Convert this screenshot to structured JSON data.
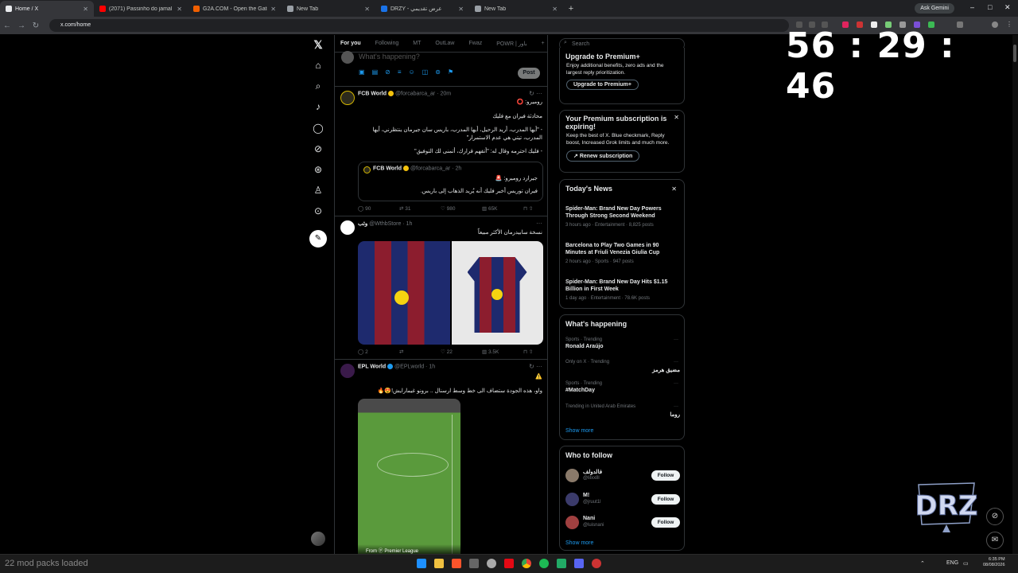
{
  "browser": {
    "tabs": [
      {
        "title": "Home / X",
        "active": true,
        "icon": "x-logo-icon",
        "color": "#e8eaed"
      },
      {
        "title": "(2071) Passinho do jamal - YouTube",
        "active": false,
        "icon": "youtube-icon",
        "color": "#ff0000"
      },
      {
        "title": "G2A.COM - Open the Gate 2 A",
        "active": false,
        "icon": "g2a-icon",
        "color": "#f05f00"
      },
      {
        "title": "New Tab",
        "active": false,
        "icon": "chrome-icon",
        "color": "#9aa0a6"
      },
      {
        "title": "DRZY - عرض تقديمي",
        "active": false,
        "icon": "slides-icon",
        "color": "#1a73e8"
      },
      {
        "title": "New Tab",
        "active": false,
        "icon": "chrome-icon",
        "color": "#9aa0a6"
      }
    ],
    "new_tab": "+",
    "ask_gemini": "Ask Gemini",
    "url": "x.com/home"
  },
  "x": {
    "tabs": [
      "For you",
      "Following",
      "MT",
      "OutLaw",
      "Fwaz",
      "POWR | باور"
    ],
    "composer_placeholder": "What's happening?",
    "post_button": "Post",
    "tweets": [
      {
        "name": "FCB World",
        "handle": "@forcabarca_ar · 20m",
        "lines": [
          "روميرو: ⭕",
          "محادثة فيران مع فليك",
          "- \"أيها المدرب، أريد الرحيل، أيها المدرب، باريس سان جيرمان ينتظرني، أيها المدرب، تيتي هي عدم الاستمرار\"",
          "- فليك احترمه وقال له: \"أتفهم قرارك، أتمنى لك التوفيق\""
        ],
        "quote": {
          "name": "FCB World",
          "handle": "@forcabarca_ar · 2h",
          "lines": [
            "جيرارد روميرو: 🚨",
            "فيران توريس أخبر فليك أنه يُريد الذهاب إلى باريس."
          ]
        },
        "stats": [
          "90",
          "31",
          "980",
          "65K"
        ]
      },
      {
        "name": "وثب",
        "handle": "@WthbStore · 1h",
        "lines": [
          "نسخة سابيدرمان الأكثر مبيعاً"
        ],
        "stats": [
          "2",
          "",
          "22",
          "3.5K"
        ]
      },
      {
        "name": "EPL World",
        "handle": "@EPLworld · 1h",
        "lines": [
          "⚠️",
          "واو، هذه الجودة ستضاف الى خط وسط ارسنال .. برونو غيمارايش!😍🔥"
        ],
        "media_caption": "From ⓟ Premier League"
      }
    ]
  },
  "sidebar": {
    "search_placeholder": "Search",
    "premium": {
      "title": "Upgrade to Premium+",
      "text": "Enjoy additional benefits, zero ads and the largest reply prioritization.",
      "button": "Upgrade to Premium+"
    },
    "expired": {
      "title": "Your Premium subscription is expiring!",
      "text": "Keep the best of X. Blue checkmark, Reply boost, Increased Grok limits and much more.",
      "button": "Renew subscription"
    },
    "news": {
      "title": "Today's News",
      "items": [
        {
          "headline": "Spider-Man: Brand New Day Powers Through Strong Second Weekend",
          "meta": "3 hours ago · Entertainment · 8,825 posts"
        },
        {
          "headline": "Barcelona to Play Two Games in 90 Minutes at Friuli Venezia Giulia Cup",
          "meta": "2 hours ago · Sports · 947 posts"
        },
        {
          "headline": "Spider-Man: Brand New Day Hits $1.15 Billion in First Week",
          "meta": "1 day ago · Entertainment · 78.6K posts"
        }
      ]
    },
    "happening": {
      "title": "What's happening",
      "items": [
        {
          "context": "Sports · Trending",
          "topic": "Ronald Araújo",
          "rtl": false
        },
        {
          "context": "Only on X · Trending",
          "topic": "مضيق هرمز",
          "rtl": true
        },
        {
          "context": "Sports · Trending",
          "topic": "#MatchDay",
          "rtl": false
        },
        {
          "context": "Trending in United Arab Emirates",
          "topic": "روما",
          "rtl": true
        }
      ],
      "show_more": "Show more"
    },
    "follow": {
      "title": "Who to follow",
      "items": [
        {
          "name": "فالدولف",
          "handle": "@lilxx8l",
          "color": "#8a7a6a"
        },
        {
          "name": "M!",
          "handle": "@jruut1l",
          "color": "#3b3b6b"
        },
        {
          "name": "Nani",
          "handle": "@luisnani",
          "color": "#a04040"
        }
      ],
      "button": "Follow",
      "show_more": "Show more"
    }
  },
  "overlay": {
    "timer": "56 : 29 : 46",
    "logo_text": "DRZ",
    "mods_loaded": "22 mod packs loaded"
  },
  "taskbar": {
    "lang": "ENG",
    "time": "6:35 PM",
    "date": "08/08/2026"
  }
}
